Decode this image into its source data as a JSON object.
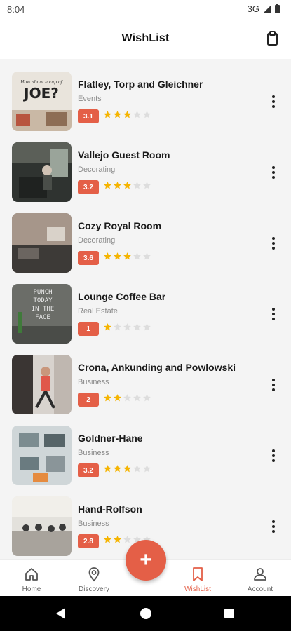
{
  "status_bar": {
    "time": "8:04",
    "network": "3G"
  },
  "header": {
    "title": "WishList",
    "action_icon": "clipboard-icon"
  },
  "items": [
    {
      "title": "Flatley, Torp and Gleichner",
      "category": "Events",
      "rating": "3.1",
      "stars": 3
    },
    {
      "title": "Vallejo Guest Room",
      "category": "Decorating",
      "rating": "3.2",
      "stars": 3
    },
    {
      "title": "Cozy Royal Room",
      "category": "Decorating",
      "rating": "3.6",
      "stars": 3
    },
    {
      "title": "Lounge Coffee Bar",
      "category": "Real Estate",
      "rating": "1",
      "stars": 1
    },
    {
      "title": "Crona, Ankunding and Powlowski",
      "category": "Business",
      "rating": "2",
      "stars": 2
    },
    {
      "title": "Goldner-Hane",
      "category": "Business",
      "rating": "3.2",
      "stars": 3
    },
    {
      "title": "Hand-Rolfson",
      "category": "Business",
      "rating": "2.8",
      "stars": 2
    }
  ],
  "thumb_texts": {
    "joe_line1": "How about a cup of",
    "joe_line2": "JOE?",
    "punch": [
      "PUNCH",
      "TODAY",
      "IN THE",
      "FACE"
    ]
  },
  "fab": {
    "label": "+"
  },
  "nav": [
    {
      "label": "Home",
      "icon": "home-icon"
    },
    {
      "label": "Discovery",
      "icon": "location-pin-icon"
    },
    {
      "label": "WishList",
      "icon": "bookmark-icon",
      "active": true
    },
    {
      "label": "Account",
      "icon": "user-icon"
    }
  ],
  "colors": {
    "accent": "#e45f47",
    "star_filled": "#f5b400",
    "star_empty": "#dddddd",
    "list_bg": "#f4f4f4"
  }
}
